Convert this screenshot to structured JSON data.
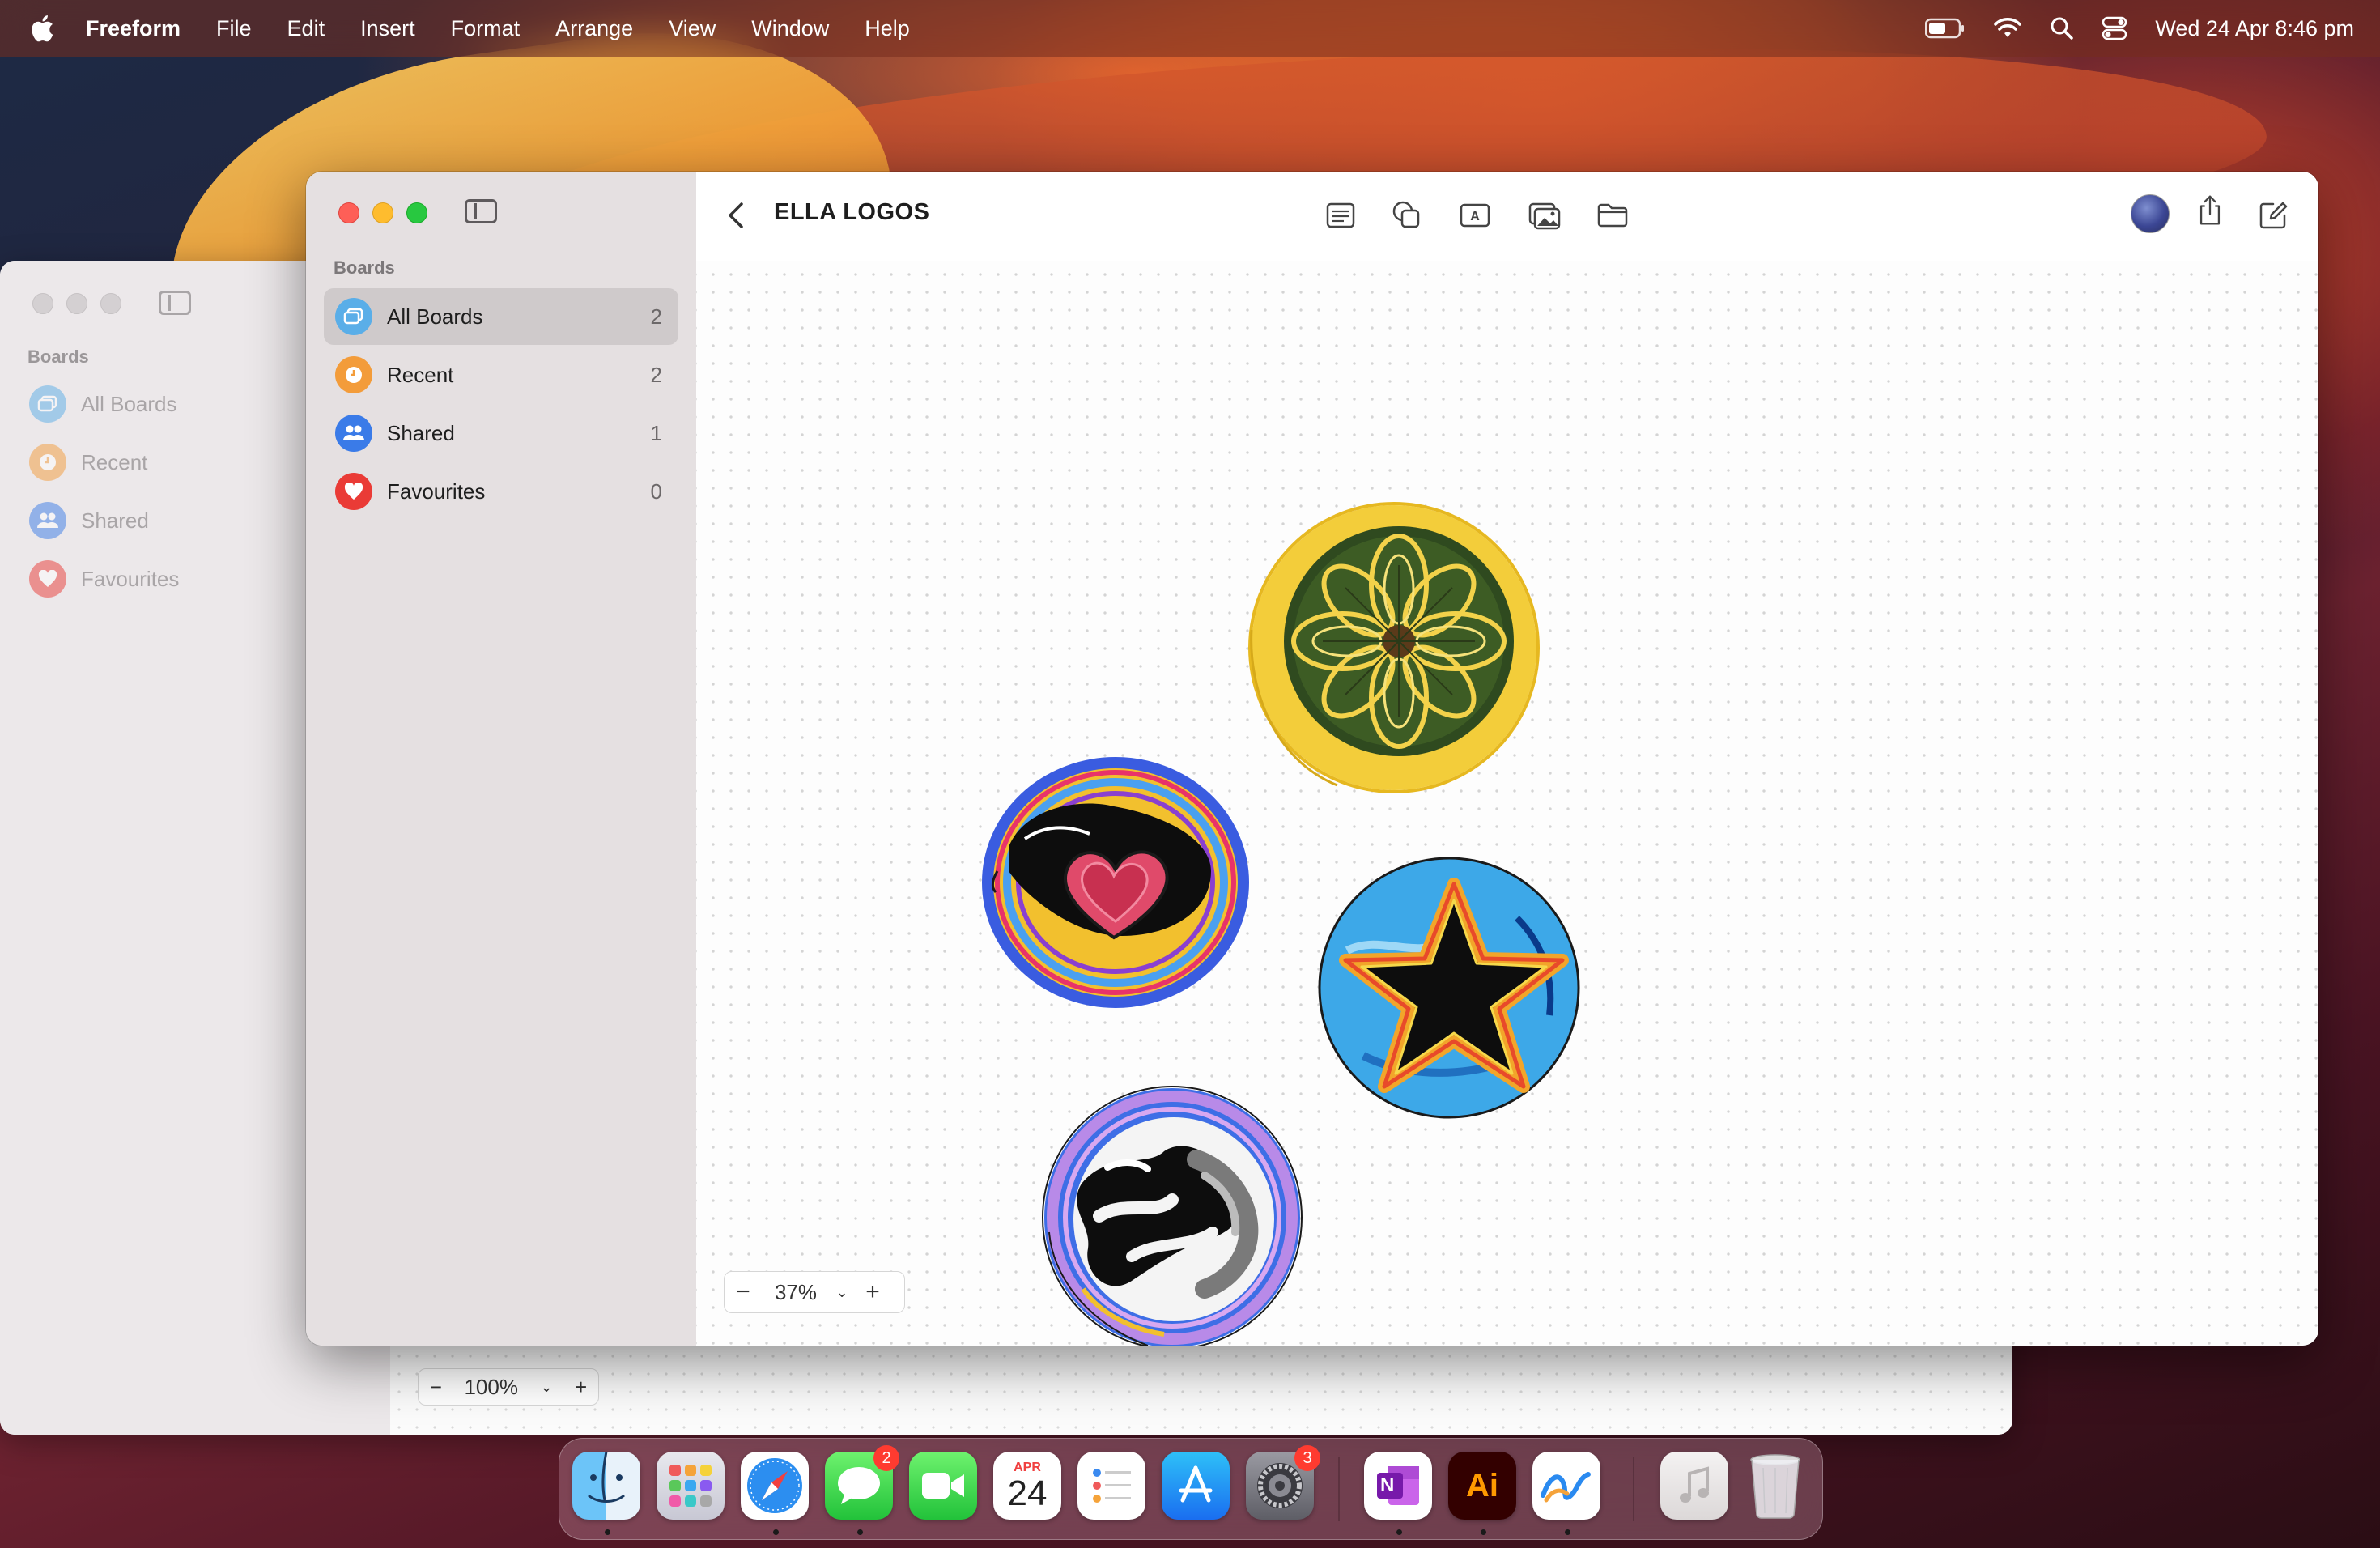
{
  "menubar": {
    "app_name": "Freeform",
    "menus": [
      "File",
      "Edit",
      "Insert",
      "Format",
      "Arrange",
      "View",
      "Window",
      "Help"
    ],
    "clock": "Wed 24 Apr  8:46 pm"
  },
  "background_window": {
    "sidebar_heading": "Boards",
    "items": [
      {
        "label": "All Boards",
        "icon": "all-boards-icon",
        "color": "#5aaee8"
      },
      {
        "label": "Recent",
        "icon": "clock-icon",
        "color": "#f39c3a"
      },
      {
        "label": "Shared",
        "icon": "people-icon",
        "color": "#3a7be8"
      },
      {
        "label": "Favourites",
        "icon": "heart-icon",
        "color": "#ea3b36"
      }
    ],
    "zoom": "100%"
  },
  "sidebar": {
    "heading": "Boards",
    "items": [
      {
        "label": "All Boards",
        "count": "2",
        "icon": "all-boards-icon",
        "color": "#5aaee8",
        "selected": true
      },
      {
        "label": "Recent",
        "count": "2",
        "icon": "clock-icon",
        "color": "#f39c3a"
      },
      {
        "label": "Shared",
        "count": "1",
        "icon": "people-icon",
        "color": "#3a7be8"
      },
      {
        "label": "Favourites",
        "count": "0",
        "icon": "heart-icon",
        "color": "#ea3b36"
      }
    ]
  },
  "toolbar": {
    "board_title": "ELLA LOGOS",
    "tools": [
      "sticky-note-icon",
      "shapes-icon",
      "text-box-icon",
      "media-icon",
      "file-icon"
    ],
    "right_tools": [
      "collaborator-avatar",
      "share-icon",
      "new-board-icon"
    ]
  },
  "canvas": {
    "zoom": "37%",
    "logos": [
      "yellow-flower-logo",
      "heart-logo",
      "star-logo",
      "cloud-logo"
    ]
  },
  "dock": {
    "apps": [
      {
        "name": "Finder",
        "running": true
      },
      {
        "name": "Launchpad",
        "running": false
      },
      {
        "name": "Safari",
        "running": true
      },
      {
        "name": "Messages",
        "running": true,
        "badge": "2"
      },
      {
        "name": "FaceTime",
        "running": false
      },
      {
        "name": "Calendar",
        "running": false,
        "month": "APR",
        "day": "24"
      },
      {
        "name": "Reminders",
        "running": false
      },
      {
        "name": "App Store",
        "running": false
      },
      {
        "name": "System Settings",
        "running": false,
        "badge": "3"
      },
      {
        "name": "OneNote",
        "running": true,
        "letter": "N"
      },
      {
        "name": "Illustrator",
        "running": true,
        "letter": "Ai"
      },
      {
        "name": "Freeform",
        "running": true
      },
      {
        "name": "Music",
        "running": false
      },
      {
        "name": "Trash",
        "running": false
      }
    ]
  }
}
